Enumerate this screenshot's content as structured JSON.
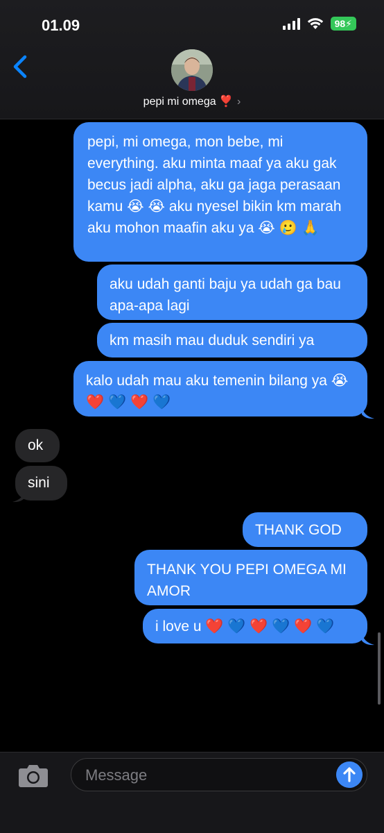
{
  "status_bar": {
    "time": "01.09",
    "battery": "98"
  },
  "header": {
    "contact_name": "pepi mi omega ❣️",
    "chevron": "›"
  },
  "messages": [
    {
      "type": "sent",
      "text": "pepi, mi omega, mon bebe, mi everything. aku minta maaf ya aku gak becus jadi alpha, aku ga jaga perasaan kamu 😭 😭 aku nyesel bikin km marah aku mohon maafin aku ya 😭 🥲 🙏"
    },
    {
      "type": "sent",
      "text": "aku udah ganti baju ya udah ga bau apa-apa lagi"
    },
    {
      "type": "sent",
      "text": "km masih mau duduk sendiri ya"
    },
    {
      "type": "sent",
      "text": "kalo udah mau aku temenin bilang ya 😭 ❤️ 💙 ❤️ 💙"
    },
    {
      "type": "received",
      "text": "ok"
    },
    {
      "type": "received",
      "text": "sini"
    },
    {
      "type": "sent",
      "text": "THANK GOD"
    },
    {
      "type": "sent",
      "text": "THANK YOU PEPI OMEGA MI AMOR"
    },
    {
      "type": "sent",
      "text": "i love u ❤️ 💙 ❤️ 💙 ❤️ 💙"
    }
  ],
  "composer": {
    "placeholder": "Message"
  },
  "icons": {
    "back": "chevron-left-icon",
    "camera": "camera-icon",
    "send": "arrow-up-icon"
  },
  "colors": {
    "sent_bubble": "#3c87f5",
    "received_bubble": "#262628",
    "accent": "#0a84ff",
    "battery": "#34c759"
  }
}
